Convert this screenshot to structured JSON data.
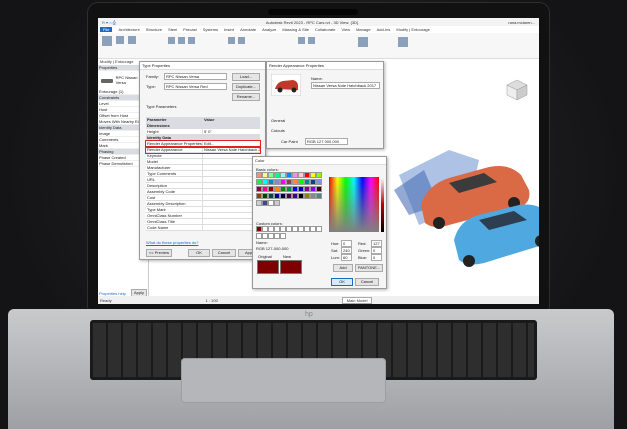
{
  "app": {
    "title": "Autodesk Revit 2023 - RPC Cars.rvt - 3D View: {3D}",
    "user": "rana.mclaren..."
  },
  "menu": [
    "File",
    "Architecture",
    "Structure",
    "Steel",
    "Precast",
    "Systems",
    "Insert",
    "Annotate",
    "Analyze",
    "Massing & Site",
    "Collaborate",
    "View",
    "Manage",
    "Add-Ins",
    "Modify | Entourage"
  ],
  "context_bar": "Modify | Entourage",
  "properties_panel": {
    "header": "Properties",
    "family": "RPC Nissan Versa",
    "items": [
      "Entourage (1)",
      "Constraints",
      "Level",
      "Host",
      "Offset from Host",
      "Moves With Nearby Elem",
      "Identity Data",
      "Image",
      "Comments",
      "Mark",
      "Phasing",
      "Phase Created",
      "Phase Demolished"
    ],
    "help_link": "Properties help",
    "apply": "Apply"
  },
  "type_properties": {
    "title": "Type Properties",
    "family_label": "Family:",
    "family_value": "RPC Nissan Versa",
    "type_label": "Type:",
    "type_value": "RPC Nissan Versa Red",
    "load": "Load...",
    "duplicate": "Duplicate...",
    "rename": "Rename...",
    "type_params": "Type Parameters",
    "col_param": "Parameter",
    "col_value": "Value",
    "rows": [
      {
        "k": "Dimensions",
        "v": "",
        "group": true
      },
      {
        "k": "Height",
        "v": "5' 0\"",
        "group": false
      },
      {
        "k": "Identity Data",
        "v": "",
        "group": true
      },
      {
        "k": "Render Appearance Properties",
        "v": "Edit...",
        "group": false,
        "hilite": true
      },
      {
        "k": "Render Appearance",
        "v": "Nissan Versa Note Hatchback 2017",
        "group": false,
        "hilite": true
      },
      {
        "k": "Keynote",
        "v": "",
        "group": false
      },
      {
        "k": "Model",
        "v": "",
        "group": false
      },
      {
        "k": "Manufacturer",
        "v": "",
        "group": false
      },
      {
        "k": "Type Comments",
        "v": "",
        "group": false
      },
      {
        "k": "URL",
        "v": "",
        "group": false
      },
      {
        "k": "Description",
        "v": "",
        "group": false
      },
      {
        "k": "Assembly Code",
        "v": "",
        "group": false
      },
      {
        "k": "Cost",
        "v": "",
        "group": false
      },
      {
        "k": "Assembly Description",
        "v": "",
        "group": false
      },
      {
        "k": "Type Mark",
        "v": "",
        "group": false
      },
      {
        "k": "OmniClass Number",
        "v": "",
        "group": false
      },
      {
        "k": "OmniClass Title",
        "v": "",
        "group": false
      },
      {
        "k": "Code Name",
        "v": "",
        "group": false
      }
    ],
    "howdo": "What do these properties do?",
    "preview": "<< Preview",
    "ok": "OK",
    "cancel": "Cancel",
    "apply": "Apply"
  },
  "render_appearance": {
    "title": "Render Appearance Properties",
    "name_label": "Name:",
    "name_value": "Nissan Versa Note Hatchback 2017",
    "general": "General",
    "cutouts": "Cutouts",
    "car_paint": "Car Paint",
    "car_paint_value": "RGB 127 000 000"
  },
  "color_dialog": {
    "title": "Color",
    "basic": "Basic colors:",
    "custom": "Custom colors:",
    "name_label": "Name:",
    "name_value": "RGB 127-000-000",
    "original": "Original",
    "new": "New",
    "hue_label": "Hue:",
    "hue": "0",
    "sat_label": "Sat:",
    "sat": "240",
    "lum_label": "Lum:",
    "lum": "60",
    "red_label": "Red:",
    "red": "127",
    "green_label": "Green:",
    "green": "0",
    "blue_label": "Blue:",
    "blue": "0",
    "add": "Add",
    "pantone": "PANTONE...",
    "ok": "OK",
    "cancel": "Cancel",
    "swatch_color": "#7f0000"
  },
  "status": {
    "text": "Ready",
    "model": "Main Model",
    "scale": "1 : 100"
  },
  "colors": {
    "accent": "#1b6ac9",
    "car_red": "#d96a45",
    "car_blue": "#4fa9e0",
    "hilite": "#d22222"
  }
}
